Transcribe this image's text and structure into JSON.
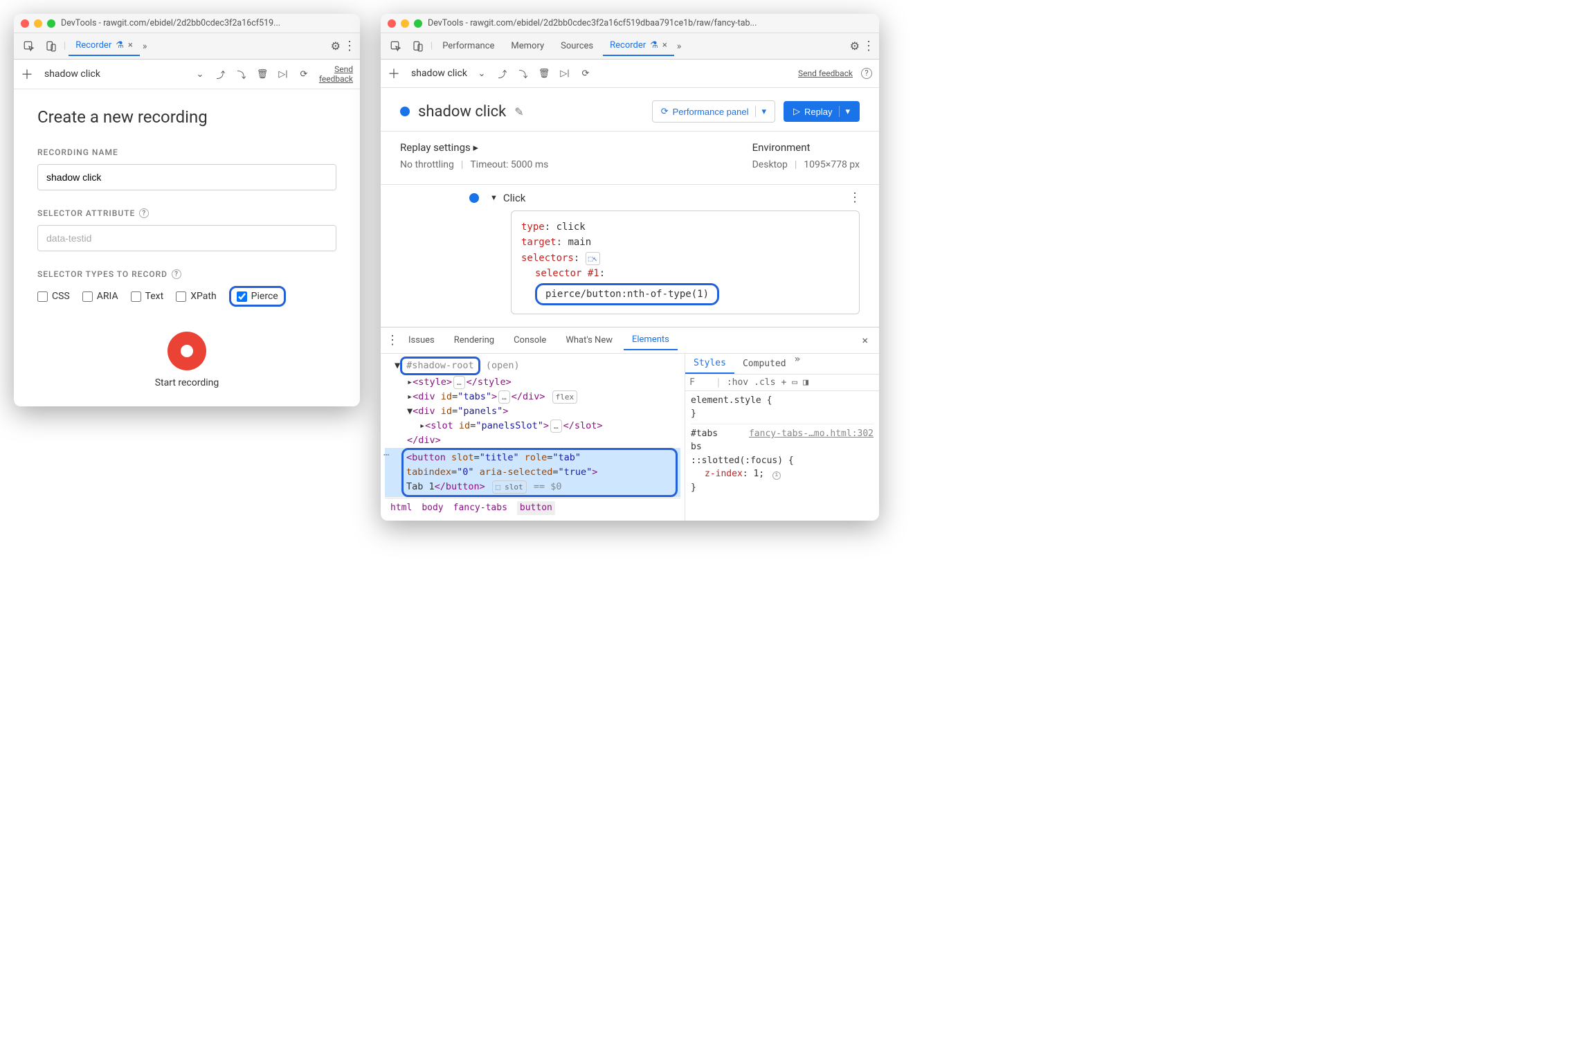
{
  "left": {
    "title": "DevTools - rawgit.com/ebidel/2d2bb0cdec3f2a16cf519...",
    "tabs": {
      "recorder": "Recorder"
    },
    "toolbar": {
      "recording_name": "shadow click",
      "send_feedback": "Send feedback"
    },
    "create": {
      "heading": "Create a new recording",
      "name_label": "RECORDING NAME",
      "name_value": "shadow click",
      "attr_label": "SELECTOR ATTRIBUTE",
      "attr_placeholder": "data-testid",
      "types_label": "SELECTOR TYPES TO RECORD",
      "types": {
        "css": "CSS",
        "aria": "ARIA",
        "text": "Text",
        "xpath": "XPath",
        "pierce": "Pierce"
      },
      "start": "Start recording"
    }
  },
  "right": {
    "title": "DevTools - rawgit.com/ebidel/2d2bb0cdec3f2a16cf519dbaa791ce1b/raw/fancy-tab...",
    "tabs": {
      "performance": "Performance",
      "memory": "Memory",
      "sources": "Sources",
      "recorder": "Recorder"
    },
    "toolbar": {
      "recording_name": "shadow click",
      "send_feedback": "Send feedback"
    },
    "head": {
      "title": "shadow click",
      "perf_panel": "Performance panel",
      "replay": "Replay"
    },
    "settings": {
      "replay_label": "Replay settings",
      "throttling": "No throttling",
      "timeout": "Timeout: 5000 ms",
      "env_label": "Environment",
      "device": "Desktop",
      "dims": "1095×778 px"
    },
    "step": {
      "name": "Click",
      "type_key": "type",
      "type_val": "click",
      "target_key": "target",
      "target_val": "main",
      "selectors_key": "selectors",
      "selnum": "selector #1",
      "selector": "pierce/button:nth-of-type(1)"
    },
    "drawer": {
      "tabs": {
        "issues": "Issues",
        "rendering": "Rendering",
        "console": "Console",
        "whatsnew": "What's New",
        "elements": "Elements"
      },
      "shadow_root": "#shadow-root",
      "shadow_mode": "(open)",
      "styles_tabs": {
        "styles": "Styles",
        "computed": "Computed"
      },
      "styles_toolbar": {
        "filter_placeholder": "F",
        "hov": ":hov",
        "cls": ".cls"
      },
      "element_style": "element.style {",
      "rule_sel": "#tabs",
      "rule_src": "fancy-tabs-…mo.html:302",
      "slotted": "::slotted(:focus) {",
      "zindex_k": "z-index",
      "zindex_v": "1",
      "breadcrumbs": [
        "html",
        "body",
        "fancy-tabs",
        "button"
      ]
    }
  }
}
